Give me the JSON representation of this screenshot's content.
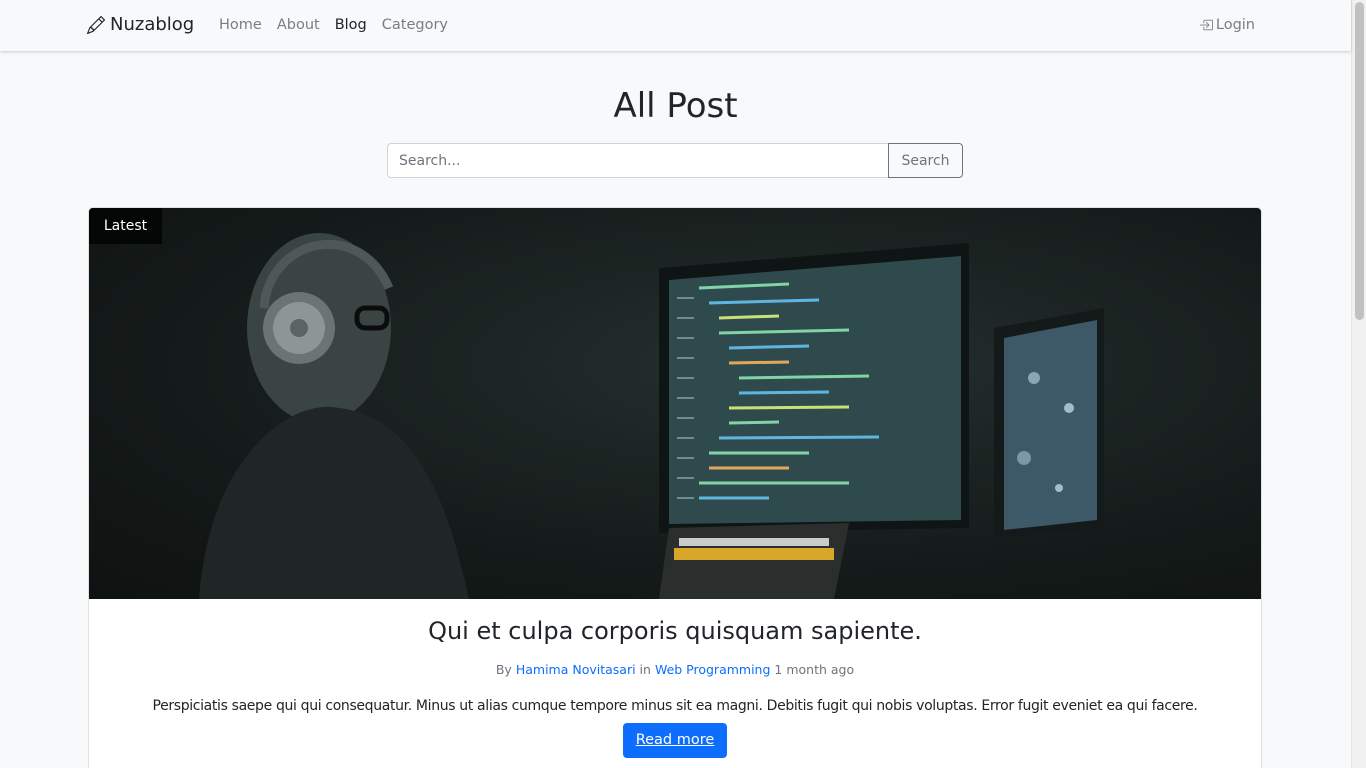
{
  "navbar": {
    "brand": "Nuzablog",
    "links": [
      {
        "label": "Home",
        "active": false
      },
      {
        "label": "About",
        "active": false
      },
      {
        "label": "Blog",
        "active": true
      },
      {
        "label": "Category",
        "active": false
      }
    ],
    "login_label": "Login"
  },
  "page": {
    "title": "All Post"
  },
  "search": {
    "placeholder": "Search...",
    "value": "",
    "button_label": "Search"
  },
  "featured_post": {
    "badge": "Latest",
    "title": "Qui et culpa corporis quisquam sapiente.",
    "meta_by": "By",
    "author": "Hamima Novitasari",
    "meta_in": "in",
    "category": "Web Programming",
    "time_ago": "1 month ago",
    "excerpt": "Perspiciatis saepe qui qui consequatur. Minus ut alias cumque tempore minus sit ea magni. Debitis fugit qui nobis voluptas. Error fugit eveniet ea qui facere.",
    "read_more_label": "Read more"
  },
  "colors": {
    "primary": "#0d6efd",
    "background": "#f8f9fa",
    "muted_text": "#6c757d"
  },
  "icons": {
    "brand_icon": "pencil-icon",
    "login_icon": "box-arrow-in-right-icon"
  }
}
